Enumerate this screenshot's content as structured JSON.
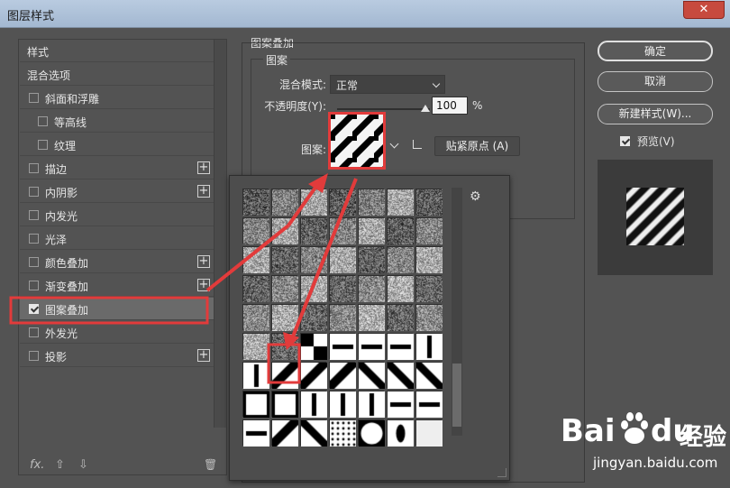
{
  "window": {
    "title": "图层样式",
    "close": "✕"
  },
  "left_panel": {
    "items": [
      {
        "label": "样式",
        "checkbox": false,
        "plus": false,
        "indent": 0
      },
      {
        "label": "混合选项",
        "checkbox": false,
        "plus": false,
        "indent": 0
      },
      {
        "label": "斜面和浮雕",
        "checkbox": true,
        "checked": false,
        "plus": false,
        "indent": 0
      },
      {
        "label": "等高线",
        "checkbox": true,
        "checked": false,
        "plus": false,
        "indent": 1
      },
      {
        "label": "纹理",
        "checkbox": true,
        "checked": false,
        "plus": false,
        "indent": 1
      },
      {
        "label": "描边",
        "checkbox": true,
        "checked": false,
        "plus": true,
        "indent": 0
      },
      {
        "label": "内阴影",
        "checkbox": true,
        "checked": false,
        "plus": true,
        "indent": 0
      },
      {
        "label": "内发光",
        "checkbox": true,
        "checked": false,
        "plus": false,
        "indent": 0
      },
      {
        "label": "光泽",
        "checkbox": true,
        "checked": false,
        "plus": false,
        "indent": 0
      },
      {
        "label": "颜色叠加",
        "checkbox": true,
        "checked": false,
        "plus": true,
        "indent": 0
      },
      {
        "label": "渐变叠加",
        "checkbox": true,
        "checked": false,
        "plus": true,
        "indent": 0
      },
      {
        "label": "图案叠加",
        "checkbox": true,
        "checked": true,
        "plus": false,
        "indent": 0,
        "selected": true
      },
      {
        "label": "外发光",
        "checkbox": true,
        "checked": false,
        "plus": false,
        "indent": 0
      },
      {
        "label": "投影",
        "checkbox": true,
        "checked": false,
        "plus": true,
        "indent": 0
      }
    ],
    "bottom": {
      "fx": "fx.",
      "up": "⇧",
      "down": "⇩",
      "trash": "🗑"
    },
    "plus_glyph": "+"
  },
  "pattern_overlay": {
    "section_title": "图案叠加",
    "subsection_title": "图案",
    "blend_mode_label": "混合模式:",
    "blend_mode_value": "正常",
    "opacity_label": "不透明度(Y):",
    "opacity_value": "100",
    "opacity_percent": 100,
    "opacity_unit": "%",
    "pattern_label": "图案:",
    "snap_button": "贴紧原点 (A)"
  },
  "buttons": {
    "ok": "确定",
    "cancel": "取消",
    "new_style": "新建样式(W)..."
  },
  "preview": {
    "label": "预览(V)",
    "checked": true
  },
  "watermark": {
    "brand": "Bai",
    "brand2": "du",
    "cn": "经验",
    "url": "jingyan.baidu.com"
  },
  "colors": {
    "accent_red": "#e23b3b"
  }
}
